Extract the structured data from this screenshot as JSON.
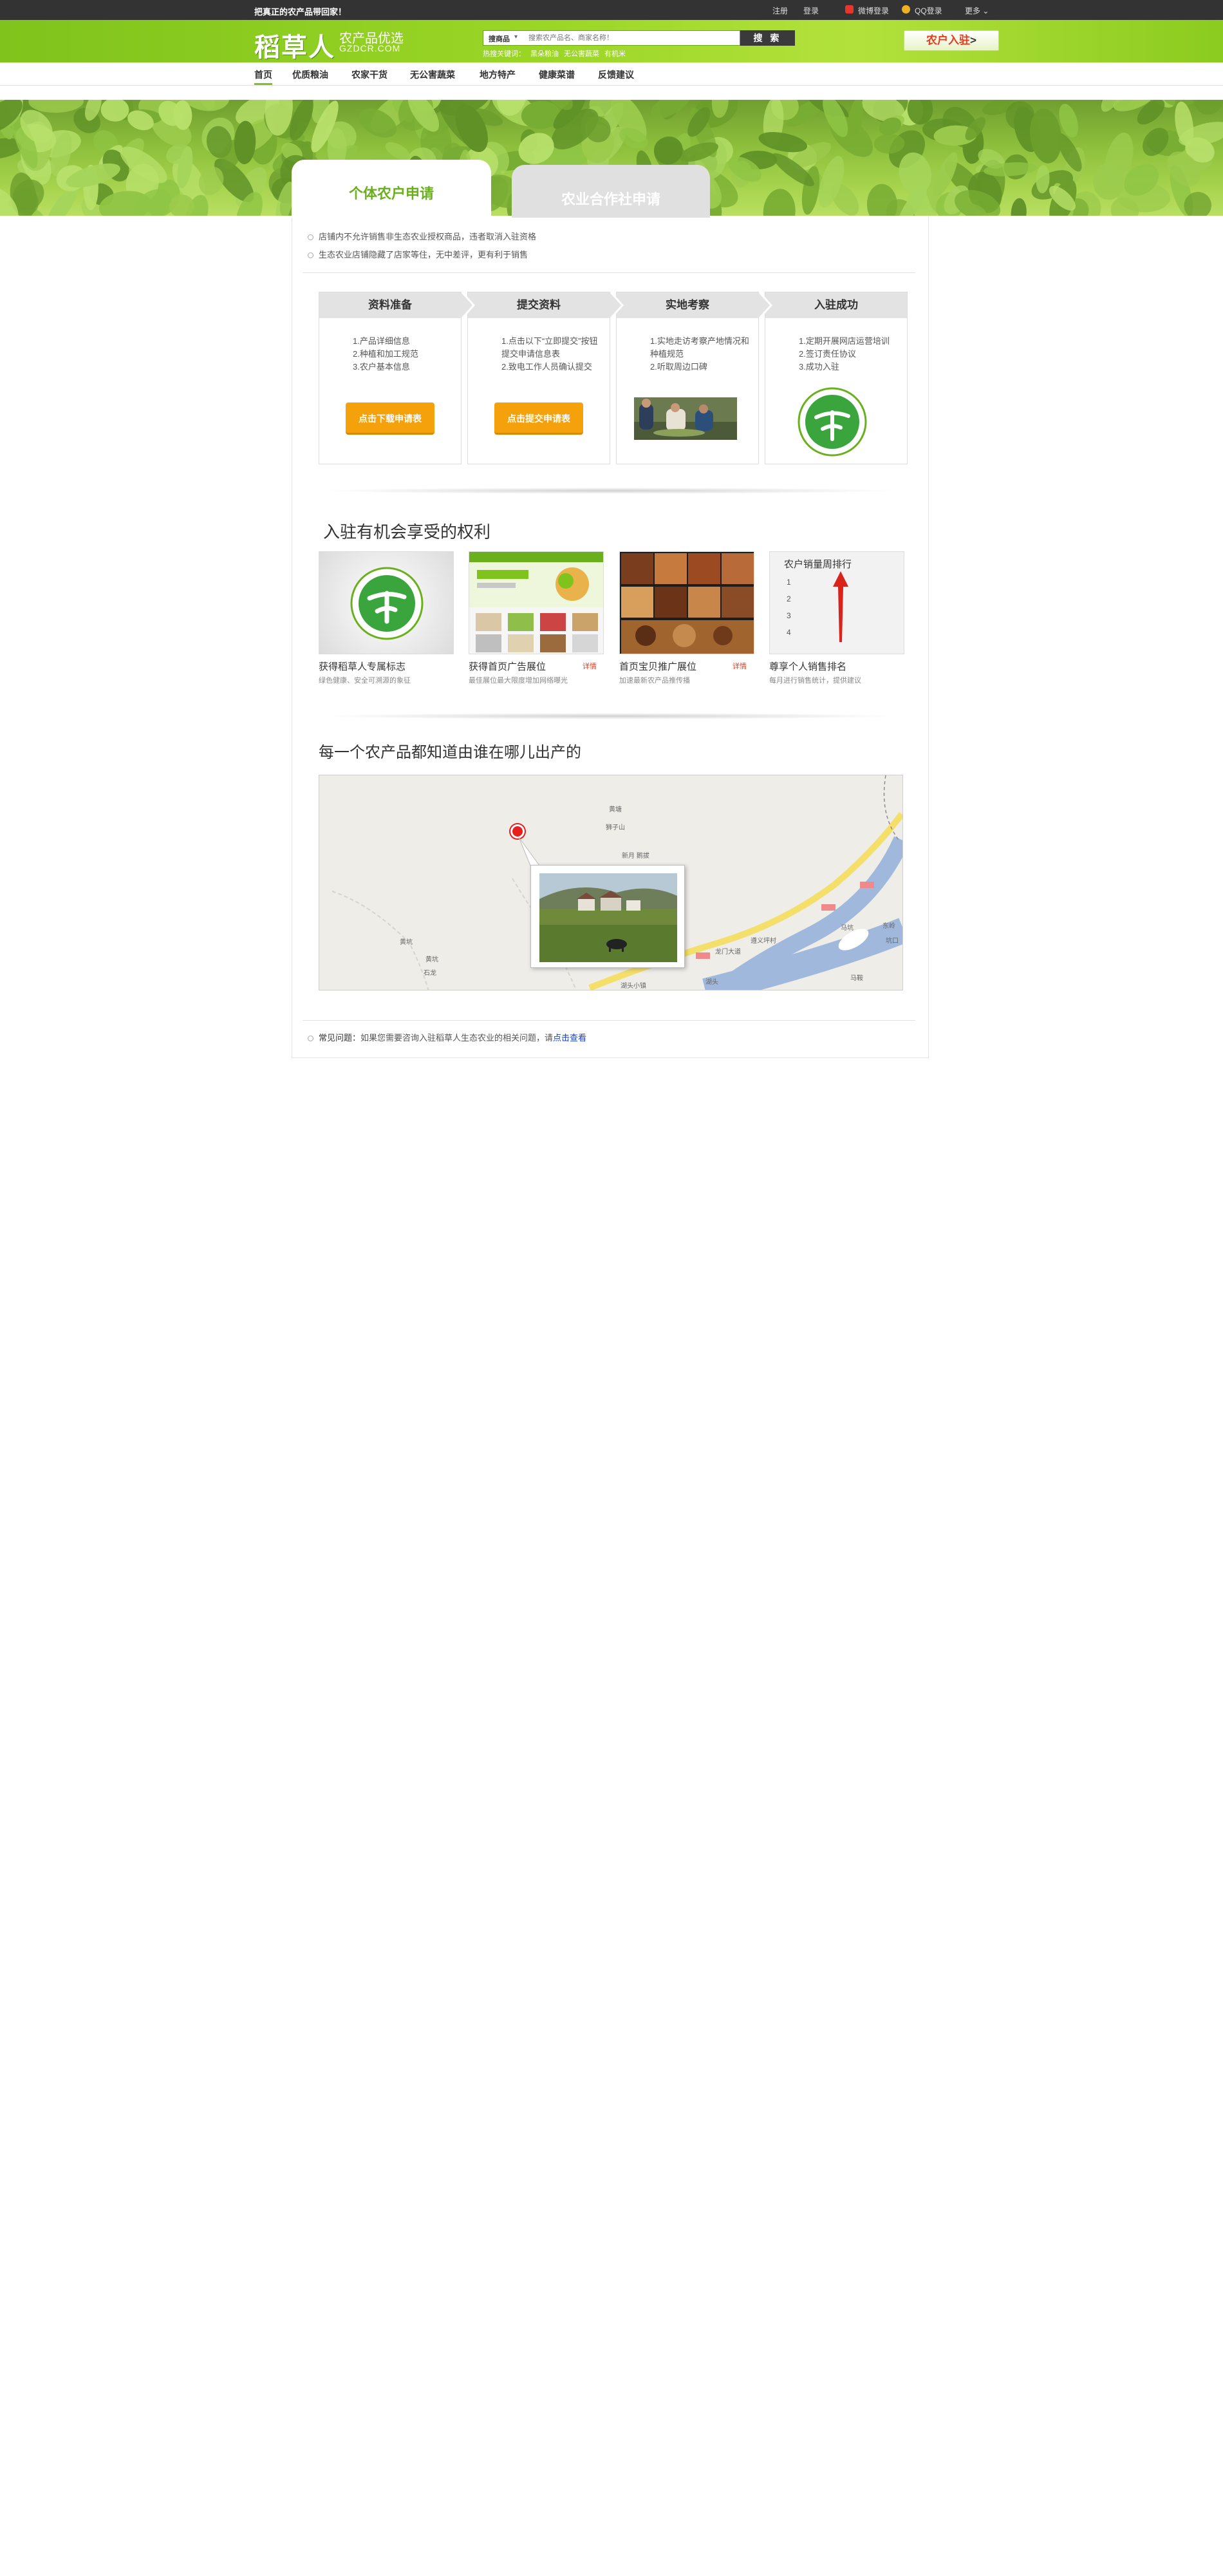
{
  "topbar": {
    "slogan": "把真正的农产品带回家！",
    "register": "注册",
    "login": "登录",
    "weibo_login": "微博登录",
    "qq_login": "QQ登录",
    "more": "更多"
  },
  "header": {
    "logo_text": "稻草人",
    "logo_sub": "农产品优选",
    "logo_domain": "GZDCR.COM",
    "search": {
      "category": "搜商品",
      "placeholder": "搜索农产品名、商家名称！",
      "button": "搜 索"
    },
    "hotwords": {
      "label": "热搜关键词：",
      "items": [
        "黑朵粮油",
        "无公害蔬菜",
        "有机米"
      ]
    },
    "join": {
      "part1": "农户",
      "part2": "入驻",
      "arrow": ">"
    }
  },
  "nav": {
    "items": [
      "首页",
      "优质粮油",
      "农家干货",
      "无公害蔬菜",
      "地方特产",
      "健康菜谱",
      "反馈建议"
    ]
  },
  "tabs": {
    "individual": "个体农户申请",
    "cooperative": "农业合作社申请"
  },
  "notes": [
    "店铺内不允许销售非生态农业授权商品，违者取消入驻资格",
    "生态农业店铺隐藏了店家等住，无中差评，更有利于销售"
  ],
  "steps": [
    {
      "title": "资料准备",
      "lines": [
        "1.产品详细信息",
        "2.种植和加工规范",
        "3.农户基本信息"
      ],
      "button": "点击下载申请表"
    },
    {
      "title": "提交资料",
      "lines": [
        "1.点击以下“立即提交”按钮提交申请信息表",
        "2.致电工作人员确认提交"
      ],
      "button": "点击提交申请表"
    },
    {
      "title": "实地考察",
      "lines": [
        "1.实地走访考察产地情况和种植规范",
        "2.听取周边口碑"
      ]
    },
    {
      "title": "入驻成功",
      "lines": [
        "1.定期开展网店运营培训",
        "2.签订责任协议",
        "3.成功入驻"
      ]
    }
  ],
  "benefits": {
    "heading": "入驻有机会享受的权利",
    "items": [
      {
        "title": "获得稻草人专属标志",
        "desc": "绿色健康、安全可溯源的象征",
        "more": ""
      },
      {
        "title": "获得首页广告展位",
        "desc": "最佳展位最大限度增加网络曝光",
        "more": "详情"
      },
      {
        "title": "首页宝贝推广展位",
        "desc": "加速最新农产品推传播",
        "more": "详情"
      },
      {
        "title": "尊享个人销售排名",
        "desc": "每月进行销售统计，提供建议",
        "more": ""
      }
    ],
    "ranking_title": "农户销量周排行",
    "ranking_nums": [
      "1",
      "2",
      "3",
      "4"
    ]
  },
  "origin": {
    "heading": "每一个农产品都知道由谁在哪儿出产的",
    "map_labels": [
      "黄塘",
      "狮子山",
      "新月 鹅拔",
      "黄坑",
      "黄坑",
      "石龙",
      "马坑",
      "东岭",
      "龙门大道",
      "遵义坪村",
      "湖头",
      "坑口",
      "湖头小镇",
      "马鞍",
      "朱坑",
      "松坑",
      "坪石"
    ]
  },
  "faq": {
    "label": "常见问题：",
    "text": "如果您需要咨询入驻稻草人生态农业的相关问题，请",
    "link": "点击查看"
  },
  "colors": {
    "brand_green": "#7fc31c",
    "button_orange": "#f4a10b",
    "link_blue": "#1a3fd4",
    "accent_red": "#e63b1e"
  }
}
